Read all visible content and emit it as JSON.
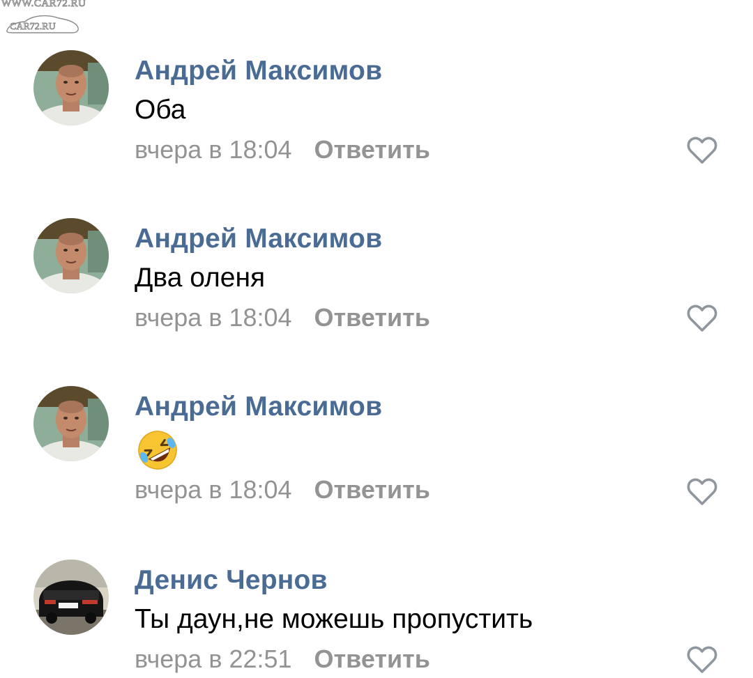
{
  "watermark": {
    "url_text": "WWW.CAR72.RU",
    "logo_text": "CAR72.RU"
  },
  "comments": [
    {
      "author": "Андрей Максимов",
      "text": "Оба",
      "time": "вчера в 18:04",
      "reply_label": "Ответить",
      "like_icon": "heart-outline-icon",
      "avatar": "avatar-andrey"
    },
    {
      "author": "Андрей Максимов",
      "text": "Два оленя",
      "time": "вчера в 18:04",
      "reply_label": "Ответить",
      "like_icon": "heart-outline-icon",
      "avatar": "avatar-andrey"
    },
    {
      "author": "Андрей Максимов",
      "text": "🤣",
      "time": "вчера в 18:04",
      "reply_label": "Ответить",
      "like_icon": "heart-outline-icon",
      "avatar": "avatar-andrey"
    },
    {
      "author": "Денис Чернов",
      "text": "Ты даун,не можешь пропустить",
      "time": "вчера в 22:51",
      "reply_label": "Ответить",
      "like_icon": "heart-outline-icon",
      "avatar": "avatar-denis"
    }
  ],
  "colors": {
    "author": "#4a6b93",
    "meta": "#939393",
    "text": "#000000",
    "background": "#ffffff"
  }
}
